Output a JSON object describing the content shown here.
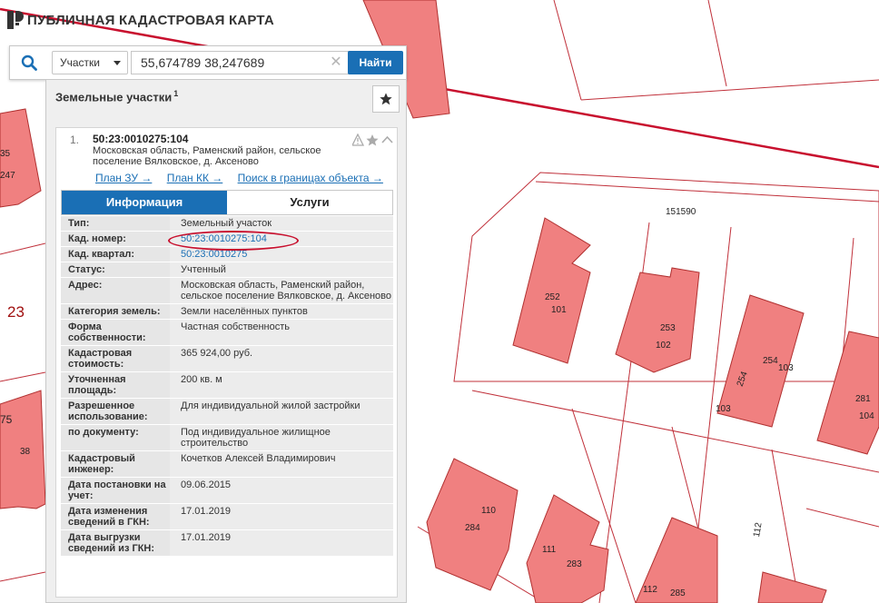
{
  "header": {
    "title": "ПУБЛИЧНАЯ КАДАСТРОВАЯ КАРТА"
  },
  "search": {
    "type_label": "Участки",
    "value": "55,674789 38,247689",
    "find_label": "Найти",
    "clear_symbol": "✕"
  },
  "panel": {
    "title": "Земельные участки",
    "count": "1"
  },
  "item": {
    "index": "1.",
    "number": "50:23:0010275:104",
    "address": "Московская область, Раменский район, сельское поселение Вялковское, д. Аксеново",
    "links": [
      "План ЗУ →",
      "План КК →",
      "Поиск в границах объекта →"
    ]
  },
  "tabs": {
    "info": "Информация",
    "services": "Услуги"
  },
  "rows": [
    {
      "label": "Тип:",
      "value": "Земельный участок"
    },
    {
      "label": "Кад. номер:",
      "value": "50:23:0010275:104",
      "link": true
    },
    {
      "label": "Кад. квартал:",
      "value": "50:23:0010275",
      "link": true
    },
    {
      "label": "Статус:",
      "value": "Учтенный"
    },
    {
      "label": "Адрес:",
      "value": "Московская область, Раменский район, сельское поселение Вялковское, д. Аксеново"
    },
    {
      "label": "Категория земель:",
      "value": "Земли населённых пунктов"
    },
    {
      "label": "Форма собственности:",
      "value": "Частная собственность"
    },
    {
      "label": "Кадастровая стоимость:",
      "value": "365 924,00 руб."
    },
    {
      "label": "Уточненная площадь:",
      "value": "200 кв. м"
    },
    {
      "label": "Разрешенное использование:",
      "value": "Для индивидуальной жилой застройки"
    },
    {
      "label": "по документу:",
      "value": "Под индивидуальное жилищное строительство"
    },
    {
      "label": "Кадастровый инженер:",
      "value": "Кочетков Алексей Владимирович"
    },
    {
      "label": "Дата постановки на учет:",
      "value": "09.06.2015"
    },
    {
      "label": "Дата изменения сведений в ГКН:",
      "value": "17.01.2019"
    },
    {
      "label": "Дата выгрузки сведений из ГКН:",
      "value": "17.01.2019"
    }
  ],
  "map_labels": [
    "35",
    "247",
    "23",
    "75",
    "38",
    "151590",
    "252",
    "101",
    "253",
    "102",
    "254",
    "103",
    "254",
    "103",
    "281",
    "104",
    "110",
    "284",
    "111",
    "283",
    "112",
    "112",
    "285"
  ],
  "colors": {
    "parcel_fill": "#f08080",
    "parcel_stroke": "#b03030",
    "accent": "#1a6fb5",
    "highlight": "#c8102e"
  }
}
